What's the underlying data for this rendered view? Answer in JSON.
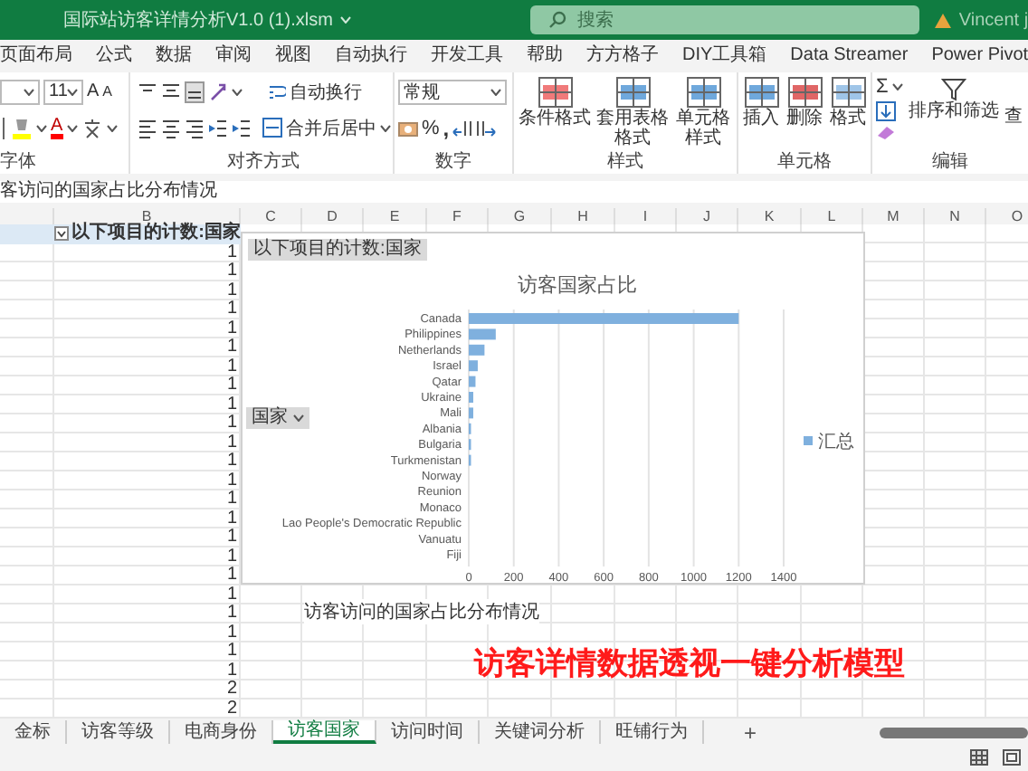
{
  "window": {
    "title": "国际站访客详情分析V1.0 (1).xlsm",
    "search_placeholder": "搜索",
    "user": "Vincent j"
  },
  "menu_tabs": [
    {
      "label": "页面布局",
      "selected": false
    },
    {
      "label": "公式",
      "selected": false
    },
    {
      "label": "数据",
      "selected": false
    },
    {
      "label": "审阅",
      "selected": false
    },
    {
      "label": "视图",
      "selected": false
    },
    {
      "label": "自动执行",
      "selected": false
    },
    {
      "label": "开发工具",
      "selected": false
    },
    {
      "label": "帮助",
      "selected": false
    },
    {
      "label": "方方格子",
      "selected": false
    },
    {
      "label": "DIY工具箱",
      "selected": false
    },
    {
      "label": "Data Streamer",
      "selected": false
    },
    {
      "label": "Power Pivot",
      "selected": false
    }
  ],
  "ribbon": {
    "font": {
      "label": "字体",
      "size": "11",
      "grow": "A",
      "shrink": "A",
      "font_color": "A"
    },
    "alignment": {
      "label": "对齐方式",
      "wrap": "自动换行",
      "merge": "合并后居中"
    },
    "number": {
      "label": "数字",
      "format": "常规",
      "percent": "%",
      "comma": ","
    },
    "styles": {
      "label": "样式",
      "buttons": [
        "条件格式",
        "套用表格格式",
        "单元格样式"
      ]
    },
    "cells": {
      "label": "单元格",
      "buttons": [
        "插入",
        "删除",
        "格式"
      ]
    },
    "editing": {
      "label": "编辑",
      "sum": "Σ",
      "sort": "排序和筛选",
      "find": "查"
    }
  },
  "formula_bar": {
    "content": "客访问的国家占比分布情况"
  },
  "sheet": {
    "columns": [
      "B",
      "C",
      "D",
      "E",
      "F",
      "G",
      "H",
      "I",
      "J",
      "K",
      "L",
      "M",
      "N",
      "O"
    ],
    "header_cell": "以下项目的计数:国家",
    "values": [
      "1",
      "1",
      "1",
      "1",
      "1",
      "1",
      "1",
      "1",
      "1",
      "1",
      "1",
      "1",
      "1",
      "1",
      "1",
      "1",
      "1",
      "1",
      "1",
      "1",
      "1",
      "1",
      "1",
      "2",
      "2"
    ],
    "note_cell": "访客访问的国家占比分布情况",
    "banner": "访客详情数据透视一键分析模型",
    "chart": {
      "field_button": "以下项目的计数:国家",
      "axis_button": "国家",
      "chart_data": {
        "type": "bar",
        "orientation": "horizontal",
        "title": "访客国家占比",
        "grid": true,
        "categories": [
          "Canada",
          "Philippines",
          "Netherlands",
          "Israel",
          "Qatar",
          "Ukraine",
          "Mali",
          "Albania",
          "Bulgaria",
          "Turkmenistan",
          "Norway",
          "Reunion",
          "Monaco",
          "Lao People's Democratic Republic",
          "Vanuatu",
          "Fiji"
        ],
        "series": [
          {
            "name": "汇总",
            "color": "#7fb0de",
            "values": [
              1200,
              120,
              70,
              40,
              30,
              20,
              20,
              10,
              10,
              10,
              0,
              0,
              0,
              0,
              0,
              0
            ]
          }
        ],
        "xlim": [
          0,
          1400
        ],
        "xticks": [
          0,
          200,
          400,
          600,
          800,
          1000,
          1200,
          1400
        ]
      }
    }
  },
  "sheet_tabs": [
    {
      "label": "金标",
      "selected": false
    },
    {
      "label": "访客等级",
      "selected": false
    },
    {
      "label": "电商身份",
      "selected": false
    },
    {
      "label": "访客国家",
      "selected": true
    },
    {
      "label": "访问时间",
      "selected": false
    },
    {
      "label": "关键词分析",
      "selected": false
    },
    {
      "label": "旺铺行为",
      "selected": false
    }
  ],
  "add_sheet": "+"
}
